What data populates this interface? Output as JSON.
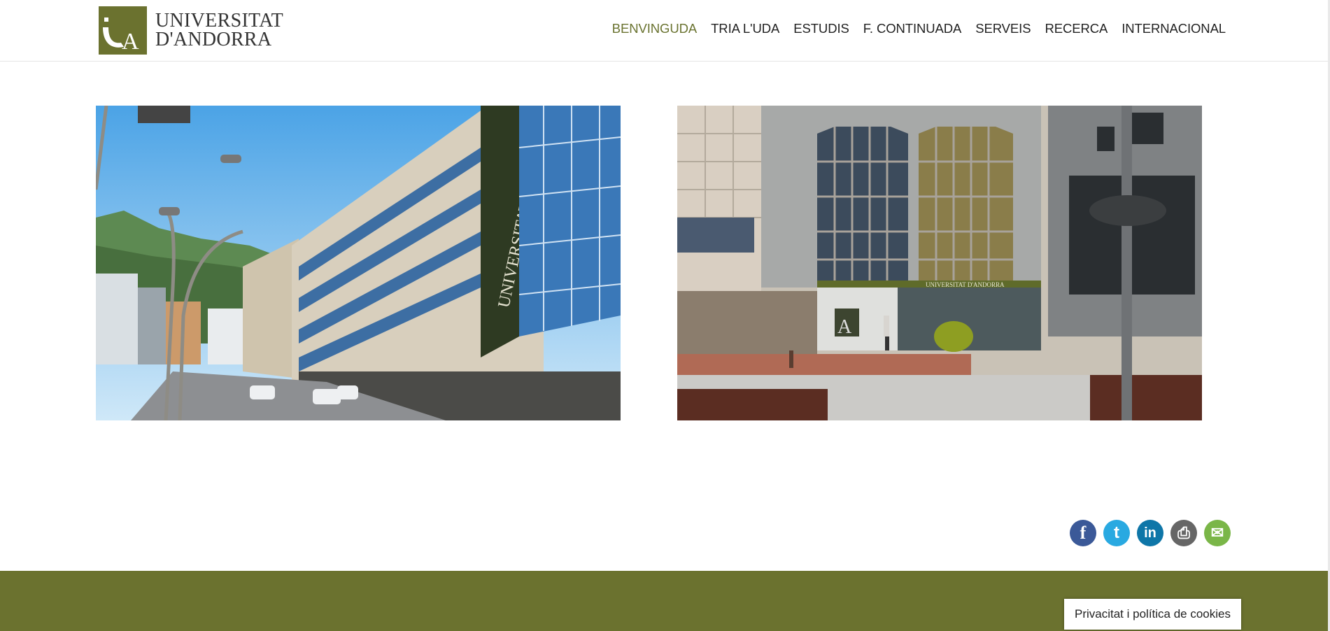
{
  "brand": {
    "line1": "UNIVERSITAT",
    "line2": "D'ANDORRA",
    "logo_letters": "UA",
    "color": "#6b722f"
  },
  "nav": {
    "items": [
      {
        "label": "BENVINGUDA",
        "active": true
      },
      {
        "label": "TRIA L'UDA",
        "active": false
      },
      {
        "label": "ESTUDIS",
        "active": false
      },
      {
        "label": "F. CONTINUADA",
        "active": false
      },
      {
        "label": "SERVEIS",
        "active": false
      },
      {
        "label": "RECERCA",
        "active": false
      },
      {
        "label": "INTERNACIONAL",
        "active": false
      }
    ]
  },
  "photos": [
    {
      "subject": "university-building-street-view",
      "sign": "UNIVERSITAT D'ANDORRA"
    },
    {
      "subject": "university-entrance-plaza",
      "sign": "UNIVERSITAT D'ANDORRA"
    }
  ],
  "share": [
    {
      "icon": "facebook-icon",
      "glyph": "f",
      "color": "#3b5998"
    },
    {
      "icon": "twitter-icon",
      "glyph": "t",
      "color": "#29a9e1"
    },
    {
      "icon": "linkedin-icon",
      "glyph": "in",
      "color": "#0e76a8"
    },
    {
      "icon": "print-icon",
      "glyph": "⎙",
      "color": "#666666"
    },
    {
      "icon": "email-icon",
      "glyph": "✉",
      "color": "#7ab648"
    }
  ],
  "cookie": {
    "label": "Privacitat i política de cookies"
  }
}
